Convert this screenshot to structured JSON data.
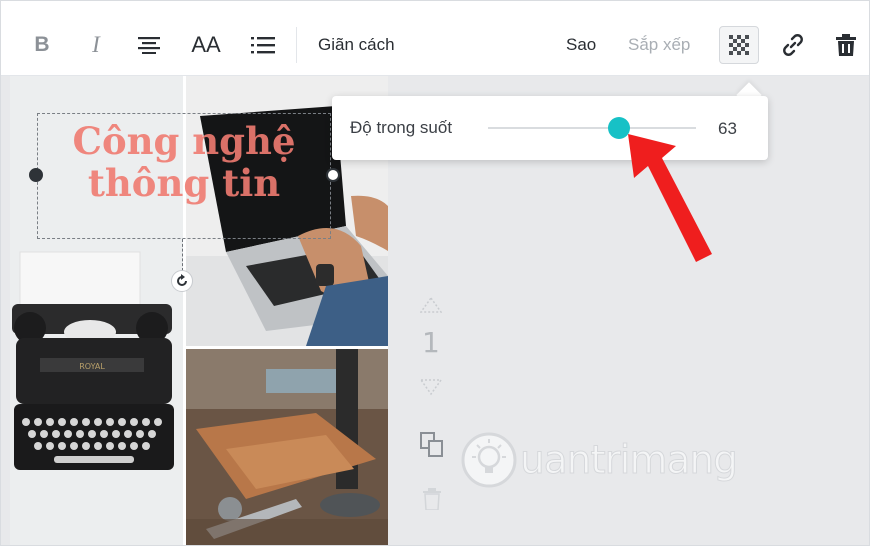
{
  "toolbar": {
    "bold_label": "B",
    "italic_label": "I",
    "case_label": "AA",
    "spacing_label": "Giãn cách",
    "copy_label": "Sao",
    "arrange_label": "Sắp xếp",
    "icons": [
      "align-center-icon",
      "list-icon",
      "transparency-icon",
      "link-icon",
      "trash-icon"
    ]
  },
  "design": {
    "text_line1": "Công nghệ",
    "text_line2": "thông tin",
    "text_color": "#f07b71"
  },
  "transparency_popup": {
    "label": "Độ trong suốt",
    "value": "63",
    "level_percent": 63,
    "accent_color": "#17c1c6"
  },
  "page_controls": {
    "page_number": "1"
  },
  "watermark": {
    "text": "uantrimang"
  },
  "annotation": {
    "arrow_color": "#ef1e1e"
  }
}
